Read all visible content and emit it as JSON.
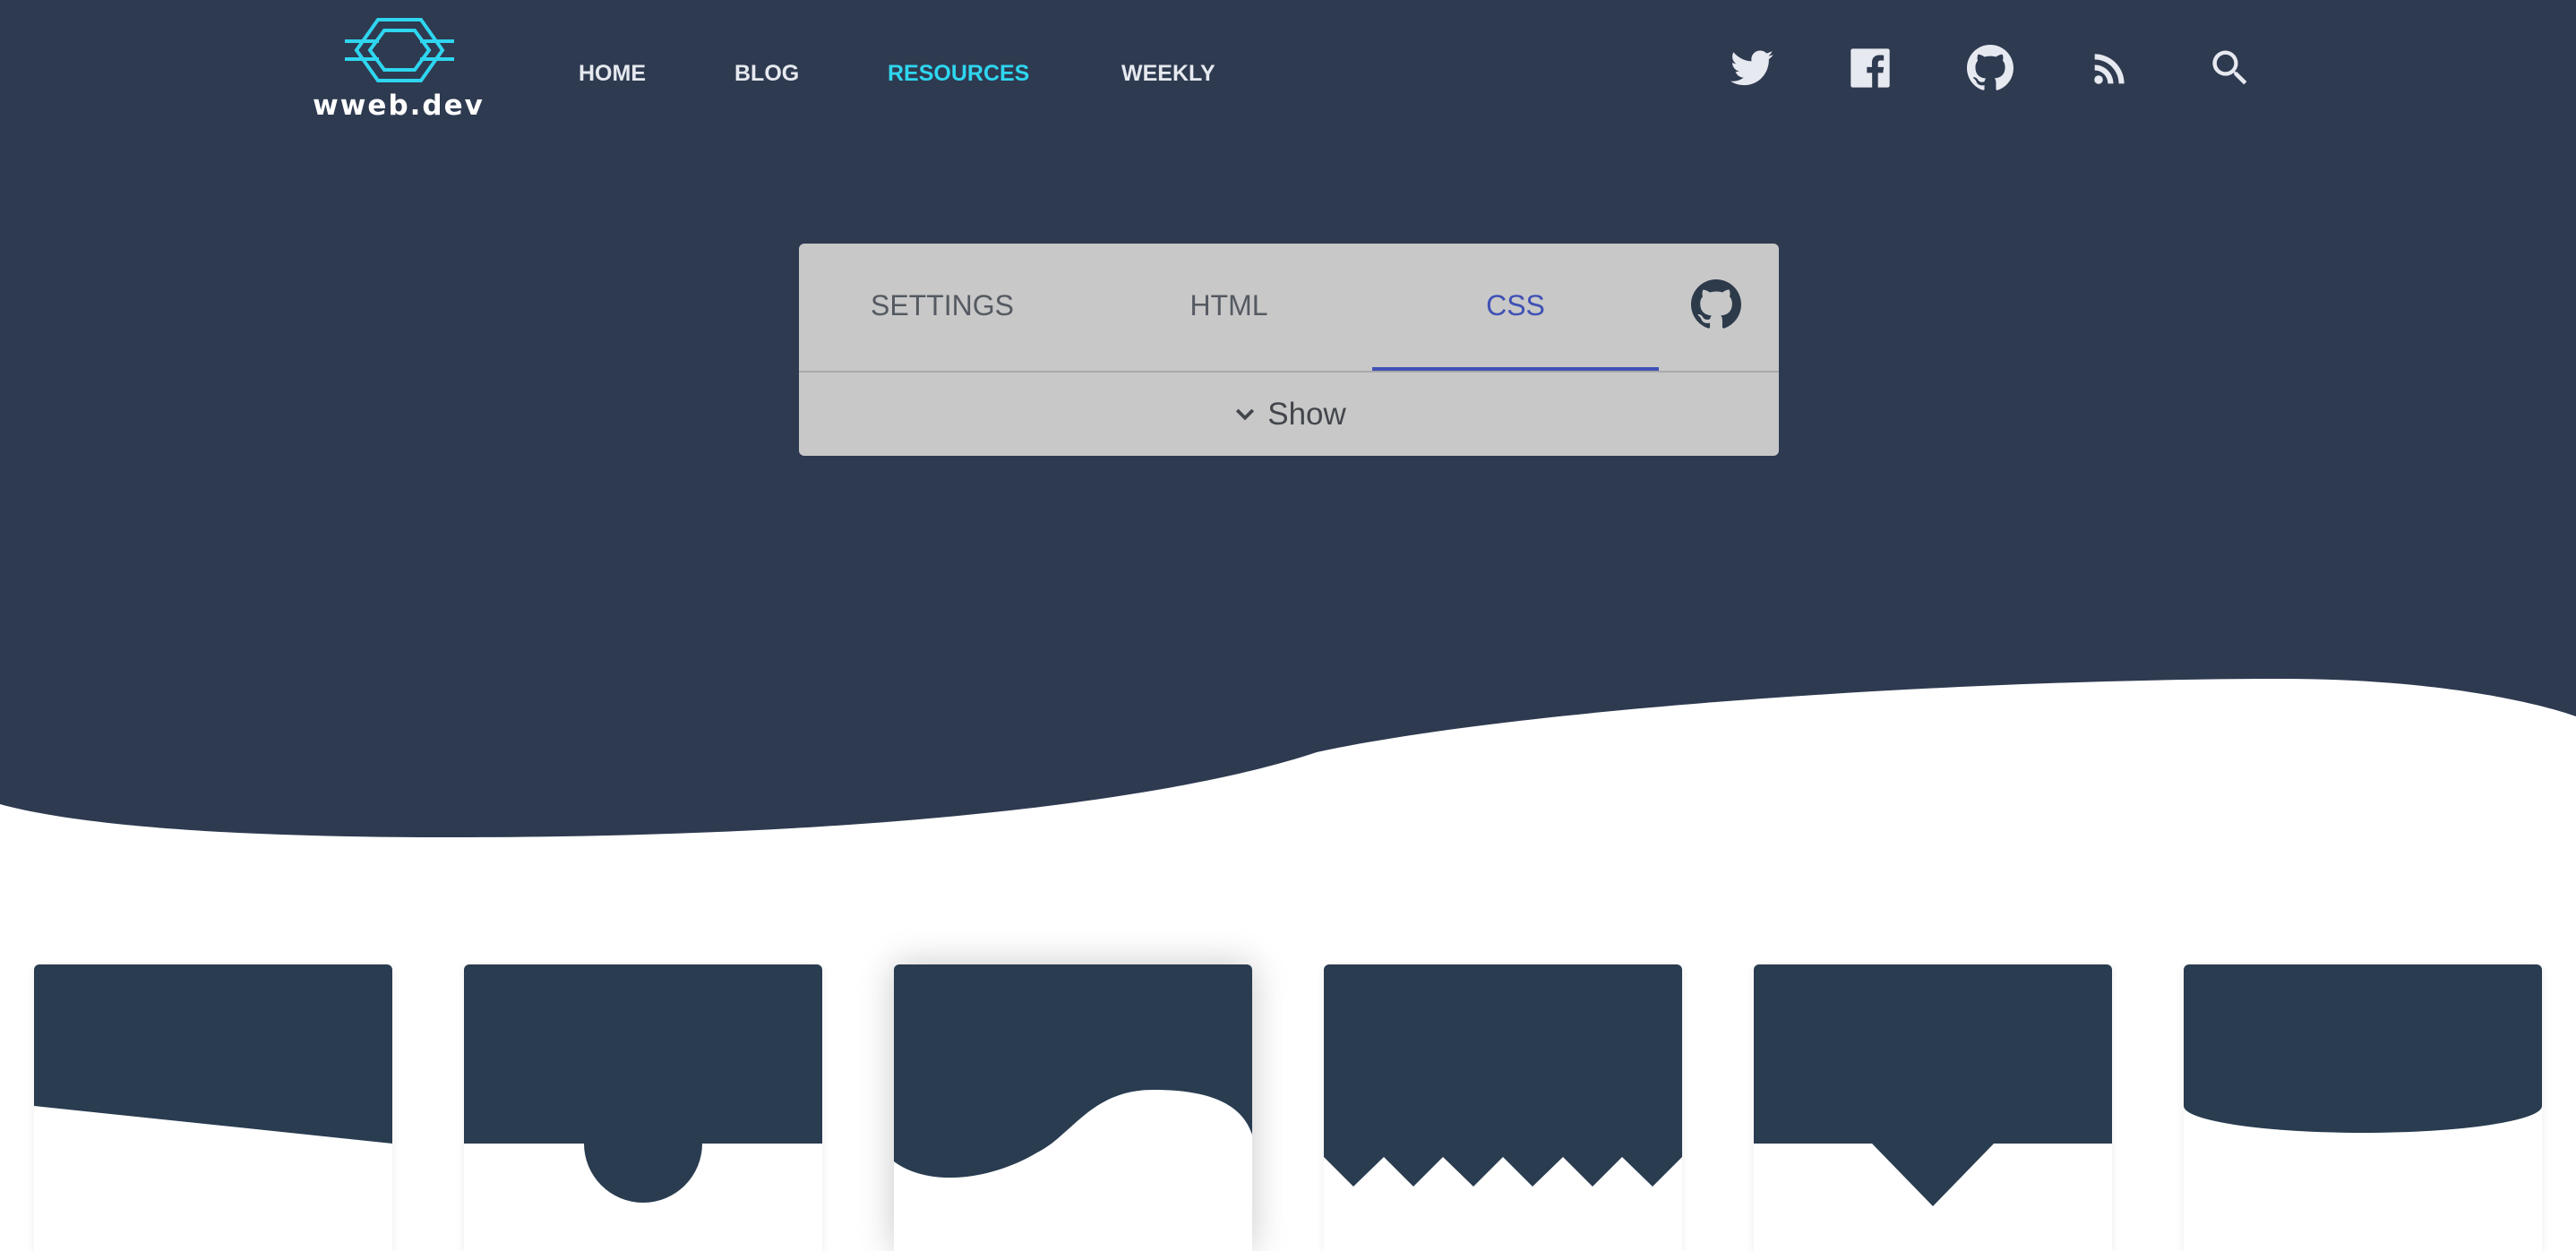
{
  "logo": {
    "text": "wweb.dev",
    "icon": "hexagon-circuit-logo",
    "accent": "#2ed6ef"
  },
  "nav": {
    "items": [
      {
        "label": "HOME",
        "active": false
      },
      {
        "label": "BLOG",
        "active": false
      },
      {
        "label": "RESOURCES",
        "active": true
      },
      {
        "label": "WEEKLY",
        "active": false
      }
    ]
  },
  "social": [
    "twitter-icon",
    "facebook-icon",
    "github-icon",
    "rss-icon",
    "search-icon"
  ],
  "colors": {
    "hero": "#2e3a50",
    "card_shape": "#293c50",
    "panel": "#c8c8c8",
    "active_tab": "#3f51b5",
    "nav_active": "#2ed6ef"
  },
  "panel": {
    "tabs": [
      {
        "label": "SETTINGS",
        "active": false
      },
      {
        "label": "HTML",
        "active": false
      },
      {
        "label": "CSS",
        "active": true
      }
    ],
    "github_icon": "github-icon",
    "show_icon": "chevron-down-icon",
    "show_label": "Show"
  },
  "cards": [
    {
      "shape": "slant",
      "active": false
    },
    {
      "shape": "circle-notch",
      "active": false
    },
    {
      "shape": "wave",
      "active": true
    },
    {
      "shape": "zigzag",
      "active": false
    },
    {
      "shape": "triangle-pointer",
      "active": false
    },
    {
      "shape": "ellipse-curve",
      "active": false
    }
  ]
}
